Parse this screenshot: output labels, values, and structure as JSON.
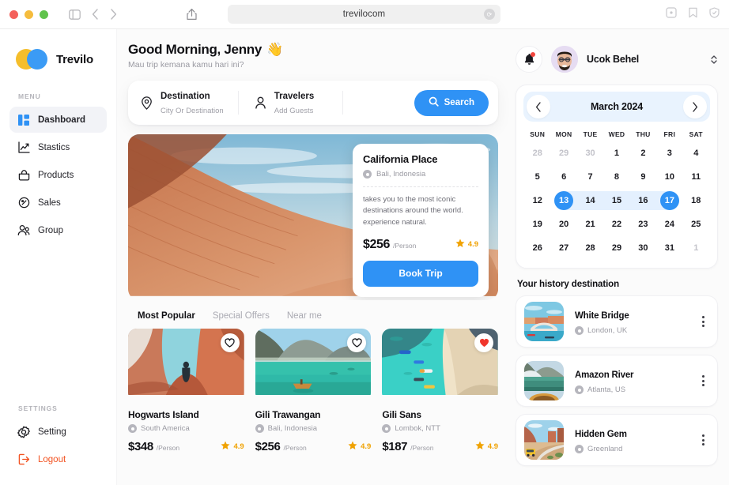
{
  "browser": {
    "url": "trevilocom",
    "icons": [
      "sidebar-toggle-icon",
      "back-icon",
      "forward-icon",
      "share-icon",
      "reload-icon",
      "new-tab-icon",
      "bookmark-icon",
      "shield-icon"
    ]
  },
  "sidebar": {
    "brand": "Trevilo",
    "menu_label": "MENU",
    "items": [
      {
        "label": "Dashboard",
        "icon": "dashboard-icon",
        "active": true
      },
      {
        "label": "Stastics",
        "icon": "chart-icon",
        "active": false
      },
      {
        "label": "Products",
        "icon": "bag-icon",
        "active": false
      },
      {
        "label": "Sales",
        "icon": "tag-icon",
        "active": false
      },
      {
        "label": "Group",
        "icon": "users-icon",
        "active": false
      }
    ],
    "settings_label": "SETTINGS",
    "settings": [
      {
        "label": "Setting",
        "icon": "gear-icon"
      },
      {
        "label": "Logout",
        "icon": "logout-icon"
      }
    ]
  },
  "header": {
    "greeting": "Good Morning, Jenny",
    "greeting_emoji": "👋",
    "subtitle": "Mau trip kemana kamu hari ini?"
  },
  "search": {
    "destination_label": "Destination",
    "destination_placeholder": "City Or Destination",
    "travelers_label": "Travelers",
    "travelers_placeholder": "Add Guests",
    "button_label": "Search"
  },
  "hero": {
    "title": "California Place",
    "location": "Bali, Indonesia",
    "description": "takes you to the most iconic destinations around the world. experience natural.",
    "price": "$256",
    "per": "/Person",
    "rating": "4.9",
    "book_label": "Book Trip"
  },
  "tabs": [
    {
      "label": "Most Popular",
      "active": true
    },
    {
      "label": "Special Offers",
      "active": false
    },
    {
      "label": "Near me",
      "active": false
    }
  ],
  "destinations": [
    {
      "title": "Hogwarts Island",
      "location": "South America",
      "price": "$348",
      "per": "/Person",
      "rating": "4.9",
      "favorited": false
    },
    {
      "title": "Gili Trawangan",
      "location": "Bali, Indonesia",
      "price": "$256",
      "per": "/Person",
      "rating": "4.9",
      "favorited": false
    },
    {
      "title": "Gili Sans",
      "location": "Lombok, NTT",
      "price": "$187",
      "per": "/Person",
      "rating": "4.9",
      "favorited": true
    }
  ],
  "user": {
    "name": "Ucok Behel",
    "has_notification": true
  },
  "calendar": {
    "title": "March 2024",
    "dow": [
      "SUN",
      "MON",
      "TUE",
      "WED",
      "THU",
      "FRI",
      "SAT"
    ],
    "range_start": 13,
    "range_end": 17,
    "weeks": [
      [
        {
          "d": "28",
          "muted": true
        },
        {
          "d": "29",
          "muted": true
        },
        {
          "d": "30",
          "muted": true
        },
        {
          "d": "1"
        },
        {
          "d": "2"
        },
        {
          "d": "3"
        },
        {
          "d": "4"
        }
      ],
      [
        {
          "d": "5"
        },
        {
          "d": "6"
        },
        {
          "d": "7"
        },
        {
          "d": "8"
        },
        {
          "d": "9"
        },
        {
          "d": "10"
        },
        {
          "d": "11"
        }
      ],
      [
        {
          "d": "12"
        },
        {
          "d": "13",
          "sel": true,
          "rstart": true
        },
        {
          "d": "14",
          "inrange": true
        },
        {
          "d": "15",
          "inrange": true
        },
        {
          "d": "16",
          "inrange": true
        },
        {
          "d": "17",
          "sel": true,
          "rend": true
        },
        {
          "d": "18"
        }
      ],
      [
        {
          "d": "19"
        },
        {
          "d": "20"
        },
        {
          "d": "21"
        },
        {
          "d": "22"
        },
        {
          "d": "23"
        },
        {
          "d": "24"
        },
        {
          "d": "25"
        }
      ],
      [
        {
          "d": "26"
        },
        {
          "d": "27"
        },
        {
          "d": "28"
        },
        {
          "d": "29"
        },
        {
          "d": "30"
        },
        {
          "d": "31"
        },
        {
          "d": "1",
          "muted": true
        }
      ]
    ]
  },
  "history": {
    "title": "Your history destination",
    "items": [
      {
        "name": "White Bridge",
        "location": "London, UK",
        "thumb": "bridge-photo"
      },
      {
        "name": "Amazon River",
        "location": "Atlanta, US",
        "thumb": "river-photo"
      },
      {
        "name": "Hidden Gem",
        "location": "Greenland",
        "thumb": "canyon-photo"
      }
    ]
  },
  "colors": {
    "accent": "#2f92f5",
    "brand_yellow": "#F5BE2B",
    "brand_blue": "#3B9BF5",
    "danger": "#f2511f",
    "star": "#f0a202",
    "range_band": "#e4f0fe"
  }
}
